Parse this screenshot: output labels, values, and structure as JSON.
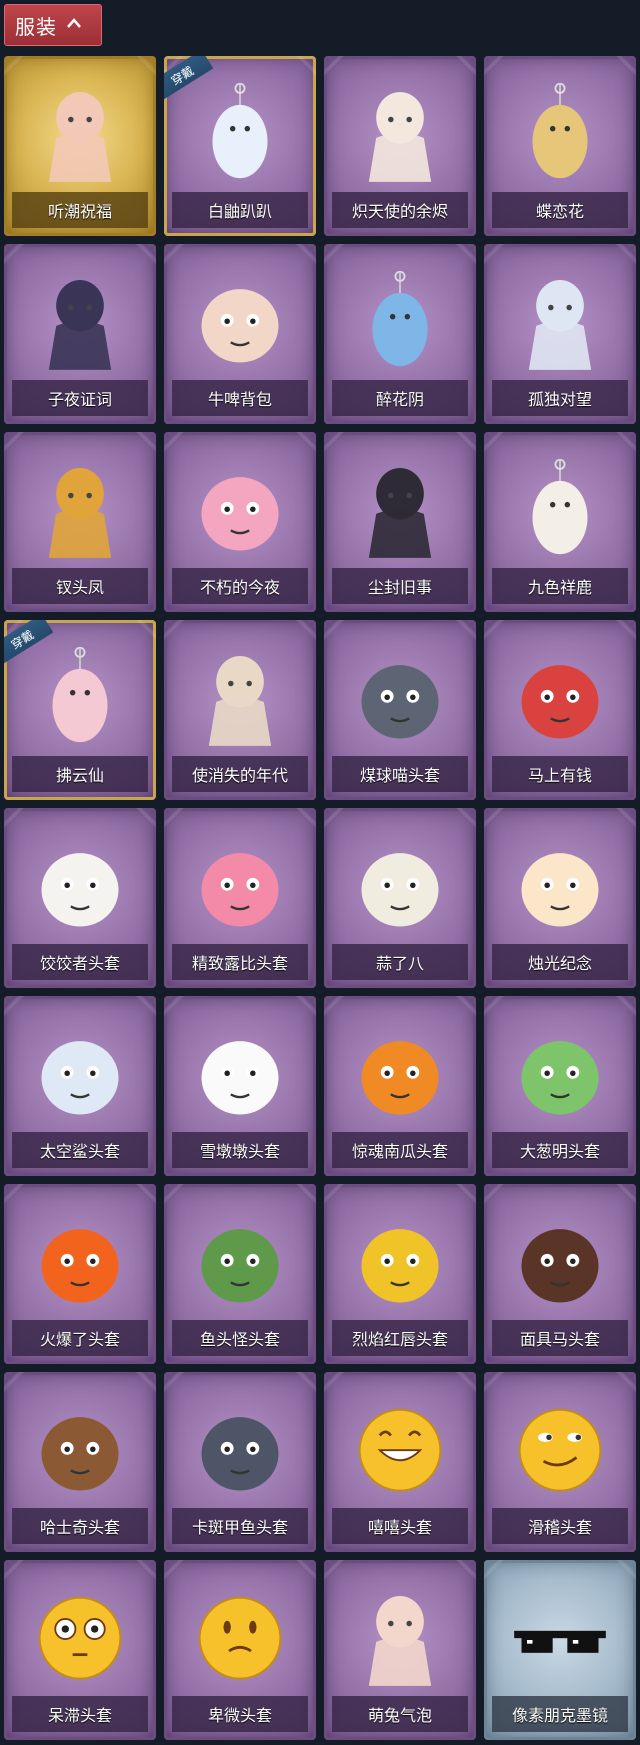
{
  "header": {
    "title": "服装",
    "toggle_icon": "chevron-up-icon"
  },
  "equipped_tag": "穿戴",
  "items": [
    {
      "label": "听潮祝福",
      "style": "gold",
      "equipped": false,
      "icon": "doll-mannequin-wings-icon",
      "color": "#f2c9b6"
    },
    {
      "label": "白鼬趴趴",
      "style": "purple",
      "equipped": true,
      "icon": "white-ferret-plush-icon",
      "color": "#e8f1fb"
    },
    {
      "label": "炽天使的余烬",
      "style": "purple",
      "equipped": false,
      "icon": "angel-doll-icon",
      "color": "#f3e7de"
    },
    {
      "label": "蝶恋花",
      "style": "purple",
      "equipped": false,
      "icon": "bell-charm-icon",
      "color": "#e6c77a"
    },
    {
      "label": "子夜证词",
      "style": "purple",
      "equipped": false,
      "icon": "plague-doctor-doll-icon",
      "color": "#3a3556"
    },
    {
      "label": "牛啤背包",
      "style": "purple",
      "equipped": false,
      "icon": "cow-beer-mug-icon",
      "color": "#f2d6c8"
    },
    {
      "label": "醉花阴",
      "style": "purple",
      "equipped": false,
      "icon": "ornament-pendant-icon",
      "color": "#7fb6e8"
    },
    {
      "label": "孤独对望",
      "style": "purple",
      "equipped": false,
      "icon": "silver-hair-doll-icon",
      "color": "#dfe6f3"
    },
    {
      "label": "钗头凤",
      "style": "purple",
      "equipped": false,
      "icon": "phoenix-crown-doll-icon",
      "color": "#e0a43a"
    },
    {
      "label": "不朽的今夜",
      "style": "purple",
      "equipped": false,
      "icon": "pink-fox-bowl-icon",
      "color": "#f4a6c0"
    },
    {
      "label": "尘封旧事",
      "style": "purple",
      "equipped": false,
      "icon": "dark-hair-doll-icon",
      "color": "#2e2a36"
    },
    {
      "label": "九色祥鹿",
      "style": "purple",
      "equipped": false,
      "icon": "deer-charm-icon",
      "color": "#f3efe6"
    },
    {
      "label": "拂云仙",
      "style": "purple",
      "equipped": true,
      "icon": "fairy-charm-icon",
      "color": "#f5c9d3"
    },
    {
      "label": "使消失的年代",
      "style": "purple",
      "equipped": false,
      "icon": "sleeping-doll-icon",
      "color": "#e9d8c6"
    },
    {
      "label": "煤球喵头套",
      "style": "purple",
      "equipped": false,
      "icon": "gray-cat-head-icon",
      "color": "#5d6474"
    },
    {
      "label": "马上有钱",
      "style": "purple",
      "equipped": false,
      "icon": "red-horse-head-icon",
      "color": "#d9423e"
    },
    {
      "label": "饺饺者头套",
      "style": "purple",
      "equipped": false,
      "icon": "dumpling-head-icon",
      "color": "#f5f3ef"
    },
    {
      "label": "精致露比头套",
      "style": "purple",
      "equipped": false,
      "icon": "pink-beaver-head-icon",
      "color": "#f28aa8"
    },
    {
      "label": "蒜了八",
      "style": "purple",
      "equipped": false,
      "icon": "garlic-head-icon",
      "color": "#f1ece0"
    },
    {
      "label": "烛光纪念",
      "style": "purple",
      "equipped": false,
      "icon": "candle-head-icon",
      "color": "#fbe6c9"
    },
    {
      "label": "太空鲨头套",
      "style": "purple",
      "equipped": false,
      "icon": "shark-head-icon",
      "color": "#dfe9f6"
    },
    {
      "label": "雪墩墩头套",
      "style": "purple",
      "equipped": false,
      "icon": "snowman-head-icon",
      "color": "#fafafa"
    },
    {
      "label": "惊魂南瓜头套",
      "style": "purple",
      "equipped": false,
      "icon": "pumpkin-head-icon",
      "color": "#f08a24"
    },
    {
      "label": "大葱明头套",
      "style": "purple",
      "equipped": false,
      "icon": "scallion-head-icon",
      "color": "#7dc46a"
    },
    {
      "label": "火爆了头套",
      "style": "purple",
      "equipped": false,
      "icon": "fire-head-icon",
      "color": "#f2641e"
    },
    {
      "label": "鱼头怪头套",
      "style": "purple",
      "equipped": false,
      "icon": "fish-head-icon",
      "color": "#5f9a4a"
    },
    {
      "label": "烈焰红唇头套",
      "style": "purple",
      "equipped": false,
      "icon": "yellow-pika-head-icon",
      "color": "#f0c428"
    },
    {
      "label": "面具马头套",
      "style": "purple",
      "equipped": false,
      "icon": "horse-mask-icon",
      "color": "#5a3426"
    },
    {
      "label": "哈士奇头套",
      "style": "purple",
      "equipped": false,
      "icon": "dog-head-sunglasses-icon",
      "color": "#8b5a34"
    },
    {
      "label": "卡斑甲鱼头套",
      "style": "purple",
      "equipped": false,
      "icon": "fish-gray-head-icon",
      "color": "#4d5566"
    },
    {
      "label": "嘻嘻头套",
      "style": "purple",
      "equipped": false,
      "icon": "grin-emoji-head-icon",
      "color": "#f6c12a"
    },
    {
      "label": "滑稽头套",
      "style": "purple",
      "equipped": false,
      "icon": "smirk-emoji-head-icon",
      "color": "#f6c12a"
    },
    {
      "label": "呆滞头套",
      "style": "purple",
      "equipped": false,
      "icon": "stare-emoji-head-icon",
      "color": "#f6c12a"
    },
    {
      "label": "卑微头套",
      "style": "purple",
      "equipped": false,
      "icon": "shy-emoji-head-icon",
      "color": "#f6c12a"
    },
    {
      "label": "萌兔气泡",
      "style": "purple",
      "equipped": false,
      "icon": "bunny-bubble-doll-icon",
      "color": "#f3d6cc"
    },
    {
      "label": "像素朋克墨镜",
      "style": "blue",
      "equipped": false,
      "icon": "pixel-sunglasses-icon",
      "color": "#111111"
    }
  ]
}
